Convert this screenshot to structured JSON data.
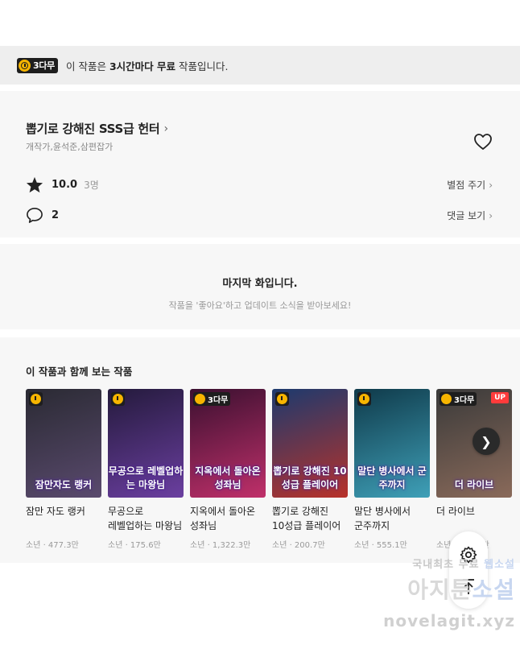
{
  "banner": {
    "badge": "3다무",
    "prefix": "이 작품은 ",
    "strong": "3시간마다 무료",
    "suffix": " 작품입니다."
  },
  "series": {
    "title": "뽑기로 강해진 SSS급 헌터",
    "authors": "개작가,윤석준,삼편잡가",
    "rating": "10.0",
    "raters": "3명",
    "comments": "2",
    "rate_action": "별점 주기",
    "comment_action": "댓글 보기"
  },
  "last_episode": {
    "title": "마지막 화입니다.",
    "subtitle": "작품을 '좋아요'하고 업데이트 소식을 받아보세요!"
  },
  "recommend": {
    "heading": "이 작품과 함께 보는 작품",
    "badge_text": "3다무",
    "up_text": "UP",
    "items": [
      {
        "name": "잠만 자도 랭커",
        "meta": "소년 · 477.3만",
        "cover_text": "잠만자도 랭커",
        "badge": "clock",
        "colors": [
          "#2a2a33",
          "#5a4a6e"
        ]
      },
      {
        "name": "무공으로 레벨업하는 마왕님",
        "meta": "소년 · 175.6만",
        "cover_text": "무공으로 레벨업하는 마왕님",
        "badge": "clock",
        "colors": [
          "#241a3c",
          "#6b3fa0"
        ]
      },
      {
        "name": "지옥에서 돌아온 성좌님",
        "meta": "소년 · 1,322.3만",
        "cover_text": "지옥에서 돌아온 성좌님",
        "badge": "3da",
        "colors": [
          "#3a1030",
          "#c0306a"
        ]
      },
      {
        "name": "뽑기로 강해진 10성급 플레이어",
        "meta": "소년 · 200.7만",
        "cover_text": "뽑기로 강해진 10성급 플레이어",
        "badge": "clock",
        "colors": [
          "#1c3a6e",
          "#b8322a"
        ]
      },
      {
        "name": "말단 병사에서 군주까지",
        "meta": "소년 · 555.1만",
        "cover_text": "말단 병사에서 군주까지",
        "badge": "clock",
        "colors": [
          "#0f3a4a",
          "#3fa0b8"
        ]
      },
      {
        "name": "더 라이브",
        "meta": "소년 · 1,254만",
        "cover_text": "더 라이브",
        "badge": "3da-up",
        "colors": [
          "#3a3a3a",
          "#8a6a5a"
        ]
      }
    ]
  },
  "watermark": {
    "line1a": "국내최초 무료 ",
    "line1b": "웹소설",
    "line2a": "아지툰",
    "line2b": "소설",
    "line3": "novelagit.xyz"
  }
}
